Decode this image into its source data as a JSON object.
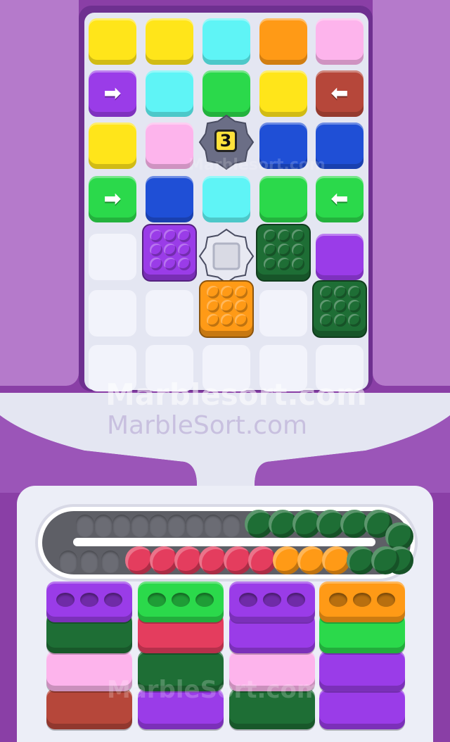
{
  "game": {
    "watermark_primary": "Marblesort.com",
    "watermark_secondary": "MarbleSort.com",
    "watermark_small": "Marblesort.com",
    "watermark_bottom": "MarbleSort.com"
  },
  "palette": {
    "yellow": "#ffe51a",
    "cyan": "#5ff4f6",
    "orange": "#ff9a16",
    "pink": "#fdb4ec",
    "purple": "#9a3ce8",
    "green": "#2bd94b",
    "red_brown": "#b6473a",
    "blue": "#1f4fd6",
    "dark_green": "#1e6e35",
    "crimson": "#e43d5e",
    "empty": "#f2f3fb"
  },
  "grid": {
    "rows": [
      [
        {
          "color": "yellow"
        },
        {
          "color": "yellow"
        },
        {
          "color": "cyan"
        },
        {
          "color": "orange"
        },
        {
          "color": "pink"
        }
      ],
      [
        {
          "color": "purple",
          "arrow": "right",
          "symbol": "➡"
        },
        {
          "color": "cyan"
        },
        {
          "color": "green"
        },
        {
          "color": "yellow"
        },
        {
          "color": "red_brown",
          "arrow": "left",
          "symbol": "⬅"
        }
      ],
      [
        {
          "color": "yellow"
        },
        {
          "color": "pink"
        },
        {
          "type": "locked-gear",
          "count": "3"
        },
        {
          "color": "blue"
        },
        {
          "color": "blue"
        }
      ],
      [
        {
          "color": "green",
          "arrow": "right",
          "symbol": "➡"
        },
        {
          "color": "blue"
        },
        {
          "color": "cyan"
        },
        {
          "color": "green"
        },
        {
          "color": "green",
          "arrow": "left",
          "symbol": "⬅"
        }
      ],
      [
        {
          "type": "empty"
        },
        {
          "type": "marble-box",
          "color": "purple"
        },
        {
          "type": "open-gear"
        },
        {
          "type": "marble-box",
          "color": "dark_green"
        },
        {
          "color": "purple"
        }
      ],
      [
        {
          "type": "empty"
        },
        {
          "type": "empty"
        },
        {
          "type": "marble-box",
          "color": "orange"
        },
        {
          "type": "empty"
        },
        {
          "type": "marble-box",
          "color": "dark_green"
        }
      ],
      [
        {
          "type": "empty"
        },
        {
          "type": "empty"
        },
        {
          "type": "empty"
        },
        {
          "type": "empty"
        },
        {
          "type": "empty"
        }
      ]
    ]
  },
  "conveyor": {
    "empty_slots": 12,
    "marbles_top": [
      "dark_green",
      "dark_green",
      "dark_green",
      "dark_green",
      "dark_green",
      "dark_green"
    ],
    "marbles_right": [
      "dark_green",
      "dark_green"
    ],
    "marbles_bottom": [
      "crimson",
      "crimson",
      "crimson",
      "crimson",
      "crimson",
      "crimson",
      "orange",
      "orange",
      "orange",
      "dark_green",
      "dark_green"
    ]
  },
  "stacks": [
    {
      "top": "purple",
      "blocks": [
        "dark_green",
        "pink",
        "red_brown"
      ]
    },
    {
      "top": "green",
      "blocks": [
        "crimson",
        "dark_green",
        "purple"
      ]
    },
    {
      "top": "purple",
      "blocks": [
        "purple",
        "pink",
        "dark_green"
      ]
    },
    {
      "top": "orange",
      "blocks": [
        "green",
        "purple",
        "purple"
      ]
    }
  ]
}
